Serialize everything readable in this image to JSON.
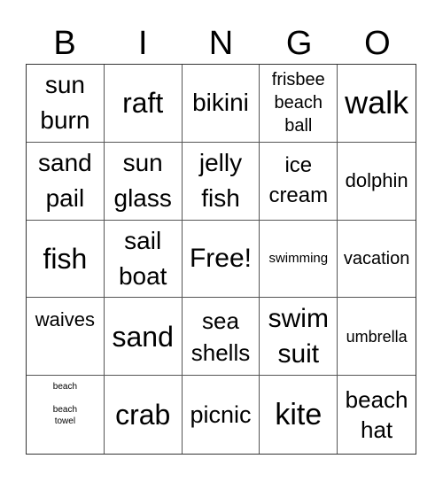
{
  "header": {
    "letters": [
      "B",
      "I",
      "N",
      "G",
      "O"
    ]
  },
  "cells": [
    {
      "text": "sun\nburn",
      "size": 28,
      "lh": 40
    },
    {
      "text": "raft",
      "size": 32,
      "lh": 36
    },
    {
      "text": "bikini",
      "size": 28,
      "lh": 32
    },
    {
      "text": "frisbee\nbeach\nball",
      "size": 20,
      "lh": 26
    },
    {
      "text": "walk",
      "size": 36,
      "lh": 40
    },
    {
      "text": "sand\npail",
      "size": 28,
      "lh": 40
    },
    {
      "text": "sun\nglass",
      "size": 28,
      "lh": 40
    },
    {
      "text": "jelly\nfish",
      "size": 28,
      "lh": 40
    },
    {
      "text": "ice\ncream",
      "size": 24,
      "lh": 34
    },
    {
      "text": "dolphin",
      "size": 22,
      "lh": 26
    },
    {
      "text": "fish",
      "size": 32,
      "lh": 36
    },
    {
      "text": "sail\nboat",
      "size": 28,
      "lh": 40
    },
    {
      "text": "Free!",
      "size": 30,
      "lh": 34
    },
    {
      "text": "swimming",
      "size": 15,
      "lh": 18
    },
    {
      "text": "vacation",
      "size": 20,
      "lh": 24
    },
    {
      "text": "waives",
      "size": 22,
      "lh": 26,
      "align": "top"
    },
    {
      "text": "sand",
      "size": 32,
      "lh": 36
    },
    {
      "text": "sea\nshells",
      "size": 26,
      "lh": 36
    },
    {
      "text": "swim\nsuit",
      "size": 30,
      "lh": 40
    },
    {
      "text": "umbrella",
      "size": 18,
      "lh": 22
    },
    {
      "text": "beach\n\nbeach\ntowel",
      "size": 10,
      "lh": 13,
      "align": "tiny"
    },
    {
      "text": "crab",
      "size": 32,
      "lh": 36
    },
    {
      "text": "picnic",
      "size": 27,
      "lh": 32
    },
    {
      "text": "kite",
      "size": 34,
      "lh": 38
    },
    {
      "text": "beach\nhat",
      "size": 26,
      "lh": 34
    }
  ]
}
